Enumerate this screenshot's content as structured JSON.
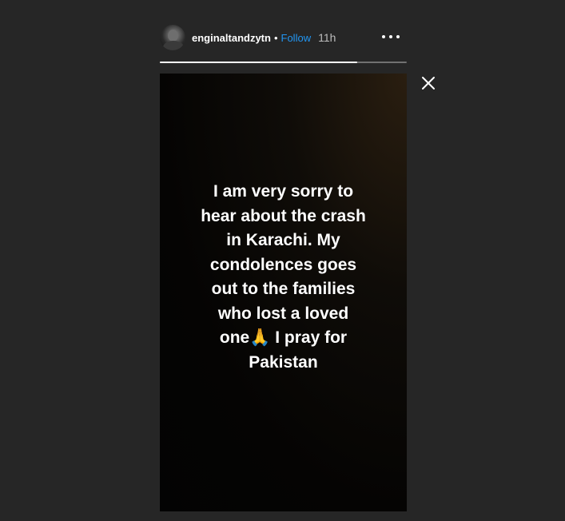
{
  "header": {
    "username": "enginaltandzytn",
    "separator": "•",
    "follow_label": "Follow",
    "time_ago": "11h"
  },
  "progress": {
    "fraction": 0.8
  },
  "story": {
    "text": "I am very sorry to\nhear about the crash\nin Karachi. My\ncondolences goes\nout to the families\nwho lost a loved\none🙏 I pray for\nPakistan"
  },
  "icons": {
    "avatar": "profile-picture",
    "more": "more-options-icon",
    "close": "close-icon"
  },
  "colors": {
    "background": "#262626",
    "follow": "#2196f3",
    "progress_fill": "#ffffff"
  }
}
